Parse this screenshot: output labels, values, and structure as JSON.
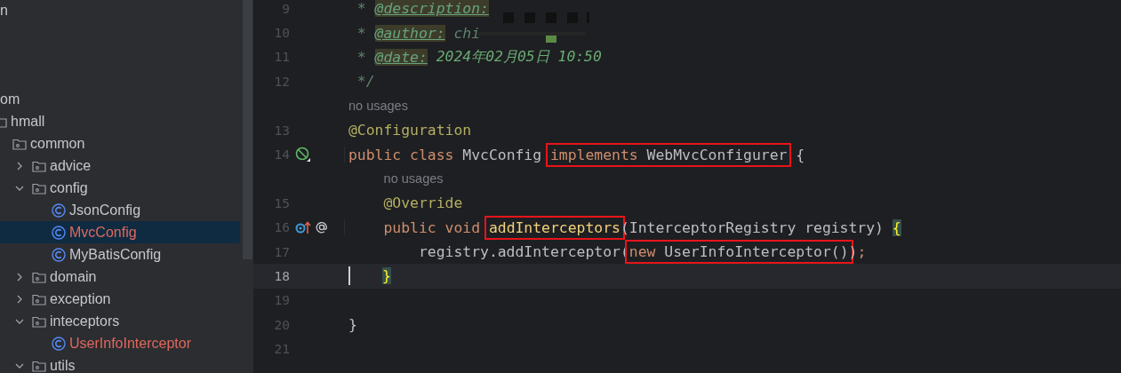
{
  "project_tree": {
    "items": [
      {
        "label": "n",
        "selected": false
      },
      {
        "label": "om",
        "selected": false,
        "children": [
          {
            "label": "hmall",
            "kind": "package",
            "selected": false,
            "children": [
              {
                "label": "common",
                "kind": "package",
                "selected": false,
                "children": [
                  {
                    "label": "advice",
                    "kind": "package",
                    "expanded": false,
                    "selected": false
                  },
                  {
                    "label": "config",
                    "kind": "package",
                    "expanded": true,
                    "selected": false,
                    "children": [
                      {
                        "label": "JsonConfig",
                        "kind": "class",
                        "unversioned": false,
                        "selected": false
                      },
                      {
                        "label": "MvcConfig",
                        "kind": "class",
                        "unversioned": true,
                        "selected": true
                      },
                      {
                        "label": "MyBatisConfig",
                        "kind": "class",
                        "unversioned": false,
                        "selected": false
                      }
                    ]
                  },
                  {
                    "label": "domain",
                    "kind": "package",
                    "expanded": false,
                    "selected": false
                  },
                  {
                    "label": "exception",
                    "kind": "package",
                    "expanded": false,
                    "selected": false
                  },
                  {
                    "label": "inteceptors",
                    "kind": "package",
                    "expanded": true,
                    "selected": false,
                    "children": [
                      {
                        "label": "UserInfoInterceptor",
                        "kind": "class",
                        "unversioned": true,
                        "selected": false
                      }
                    ]
                  },
                  {
                    "label": "utils",
                    "kind": "package",
                    "expanded": true,
                    "selected": false
                  }
                ]
              }
            ]
          }
        ]
      }
    ]
  },
  "editor": {
    "lines": [
      {
        "kind": "code",
        "number": "9",
        "current": false,
        "segments": [
          {
            "kind": "comment",
            "text": " * "
          },
          {
            "kind": "doctag",
            "text": "@description:"
          }
        ]
      },
      {
        "kind": "code",
        "number": "10",
        "current": false,
        "redacted": true,
        "segments": [
          {
            "kind": "comment",
            "text": " * "
          },
          {
            "kind": "doctag",
            "text": "@author:"
          },
          {
            "kind": "comment",
            "text": " chi"
          }
        ]
      },
      {
        "kind": "code",
        "number": "11",
        "current": false,
        "segments": [
          {
            "kind": "comment",
            "text": " * "
          },
          {
            "kind": "doctag",
            "text": "@date:"
          },
          {
            "kind": "docvalue",
            "text": " 2024年02月05日 10:50"
          }
        ]
      },
      {
        "kind": "code",
        "number": "12",
        "current": false,
        "segments": [
          {
            "kind": "comment",
            "text": " */"
          }
        ]
      },
      {
        "kind": "code",
        "number": "13",
        "current": false,
        "hint": "no usages",
        "segments": [
          {
            "kind": "annotation",
            "text": "@Configuration"
          }
        ]
      },
      {
        "kind": "code",
        "number": "14",
        "current": false,
        "gutter": [
          {
            "kind": "bean"
          }
        ],
        "segments": [
          {
            "kind": "keyword",
            "text": "public class "
          },
          {
            "kind": "plain",
            "text": "MvcConfig "
          },
          {
            "kind": "box",
            "segments": [
              {
                "kind": "keyword",
                "text": "implements "
              },
              {
                "kind": "plain",
                "text": "WebMvcConfigurer"
              }
            ]
          },
          {
            "kind": "plain",
            "text": " {"
          }
        ]
      },
      {
        "kind": "code",
        "number": "15",
        "current": false,
        "hint": "no usages",
        "segments": [
          {
            "kind": "annotation",
            "text": "    @Override"
          }
        ]
      },
      {
        "kind": "code",
        "number": "16",
        "current": false,
        "gutter": [
          {
            "kind": "overrides"
          },
          {
            "kind": "annotated"
          }
        ],
        "segments": [
          {
            "kind": "keyword",
            "text": "    public void "
          },
          {
            "kind": "box",
            "segments": [
              {
                "kind": "method",
                "text": "addInterceptors"
              }
            ]
          },
          {
            "kind": "plain",
            "text": "(InterceptorRegistry registry) "
          },
          {
            "kind": "brace",
            "text": "{"
          }
        ]
      },
      {
        "kind": "code",
        "number": "17",
        "current": false,
        "segments": [
          {
            "kind": "plain",
            "text": "        registry.addInterceptor("
          },
          {
            "kind": "box",
            "segments": [
              {
                "kind": "keyword",
                "text": "new "
              },
              {
                "kind": "plain",
                "text": "UserInfoInterceptor()"
              }
            ]
          },
          {
            "kind": "plain",
            "text": ")"
          },
          {
            "kind": "keyword",
            "text": ";"
          }
        ]
      },
      {
        "kind": "code",
        "number": "18",
        "current": true,
        "nested": true,
        "segments": [
          {
            "kind": "brace",
            "text": "}"
          }
        ]
      },
      {
        "kind": "code",
        "number": "19",
        "current": false
      },
      {
        "kind": "code",
        "number": "20",
        "current": false,
        "segments": [
          {
            "kind": "plain",
            "text": "}"
          }
        ]
      },
      {
        "kind": "code",
        "number": "21",
        "current": false
      }
    ]
  }
}
